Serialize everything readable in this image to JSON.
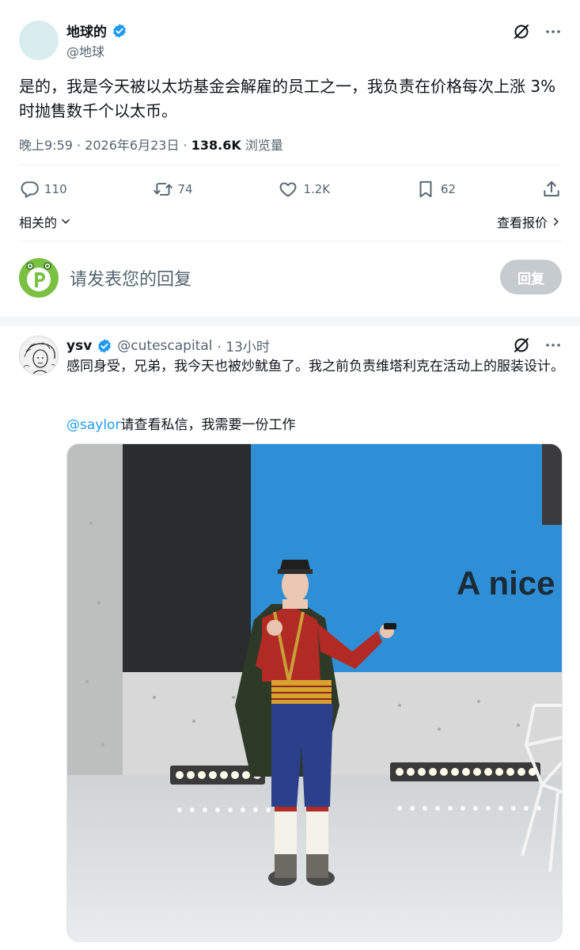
{
  "main_tweet": {
    "display_name": "地球的",
    "handle": "@地球",
    "text": "是的，我是今天被以太坊基金会解雇的员工之一，我负责在价格每次上涨 3% 时抛售数千个以太币。",
    "timestamp": "晚上9:59 · 2026年6月23日 · ",
    "views_count": "138.6K",
    "views_label": " 浏览量",
    "replies": "110",
    "retweets": "74",
    "likes": "1.2K",
    "bookmarks": "62",
    "related_label": "相关的",
    "quotes_link": "查看报价"
  },
  "reply_box": {
    "placeholder": "请发表您的回复",
    "button": "回复"
  },
  "reply_tweet": {
    "display_name": "ysv",
    "handle": "@cutescapital",
    "time": "· 13小时",
    "text": "感同身受，兄弟，我今天也被炒鱿鱼了。我之前负责维塔利克在活动上的服装设计。",
    "mention": "@saylor",
    "text2": "请查看私信，我需要一份工作",
    "photo_screen_text": "A nice"
  },
  "colors": {
    "accent": "#1d9bf0",
    "muted": "#536471",
    "reply_button_bg": "#c6cbcf"
  },
  "icons": [
    "verified-badge-icon",
    "grok-icon",
    "more-icon",
    "reply-icon",
    "retweet-icon",
    "like-icon",
    "bookmark-icon",
    "share-icon",
    "chevron-down-icon",
    "chevron-right-icon"
  ]
}
